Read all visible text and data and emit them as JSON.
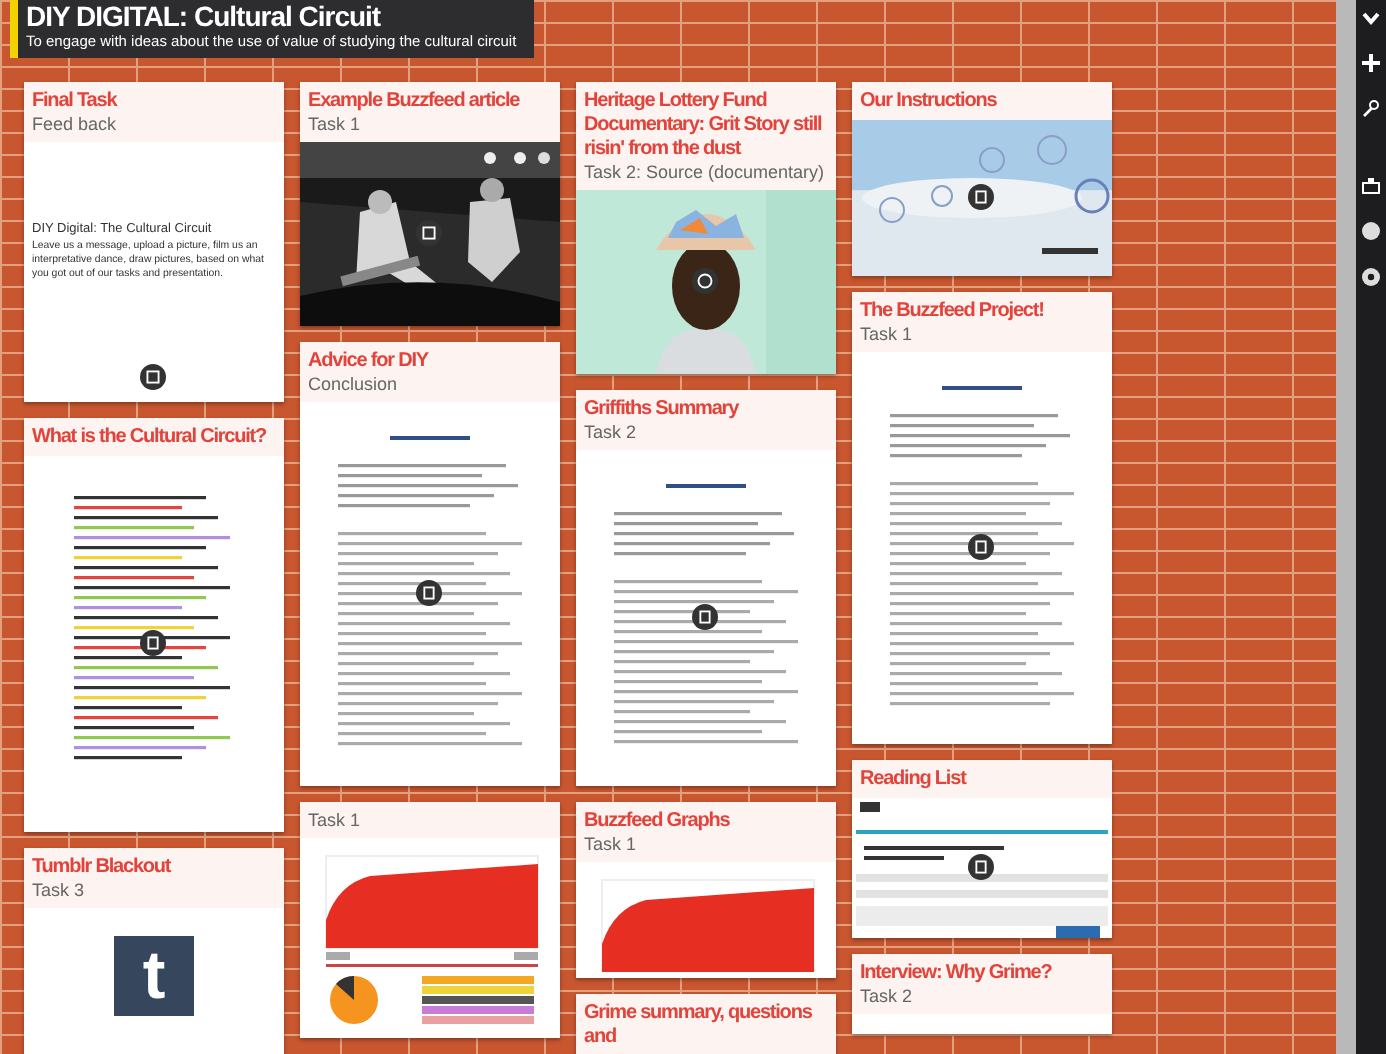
{
  "board": {
    "title": "DIY DIGITAL: Cultural Circuit",
    "description": "To engage with ideas about the use of value of studying the cultural circuit"
  },
  "columns": [
    {
      "cards": [
        {
          "title": "Final Task",
          "subtitle": "Feed back",
          "preview": {
            "kind": "note",
            "heading": "DIY Digital: The Cultural Circuit",
            "text": "Leave us a message, upload a picture, film us an interpretative dance, draw pictures, based on what you got out of our tasks and presentation."
          }
        },
        {
          "title": "What is the Cultural Circuit?",
          "preview": {
            "kind": "colordoc"
          }
        },
        {
          "title": "Tumblr Blackout",
          "subtitle": "Task 3",
          "preview": {
            "kind": "logo",
            "letter": "t"
          }
        }
      ]
    },
    {
      "cards": [
        {
          "title": "Example Buzzfeed article",
          "subtitle": "Task 1"
        },
        {
          "title": "Advice for DIY",
          "subtitle": "Conclusion",
          "preview": {
            "kind": "document"
          }
        },
        {
          "subtitle": "Task 1",
          "preview": {
            "kind": "chart"
          }
        }
      ]
    },
    {
      "cards": [
        {
          "title": "Heritage Lottery Fund Documentary: Grit Story still risin' from the dust",
          "subtitle": "Task 2: Source (documentary)",
          "preview": {
            "kind": "video"
          }
        },
        {
          "title": "Griffiths Summary",
          "subtitle": "Task 2",
          "preview": {
            "kind": "document"
          }
        },
        {
          "title": "Buzzfeed Graphs",
          "subtitle": "Task 1",
          "preview": {
            "kind": "chart"
          }
        },
        {
          "title": "Grime summary, questions and"
        }
      ]
    },
    {
      "cards": [
        {
          "title": "Our Instructions",
          "preview": {
            "kind": "slides"
          }
        },
        {
          "title": "The Buzzfeed Project!",
          "subtitle": "Task 1",
          "preview": {
            "kind": "document"
          }
        },
        {
          "title": "Reading List",
          "preview": {
            "kind": "webpage"
          }
        },
        {
          "title": "Interview: Why Grime?",
          "subtitle": "Task 2"
        }
      ]
    }
  ]
}
